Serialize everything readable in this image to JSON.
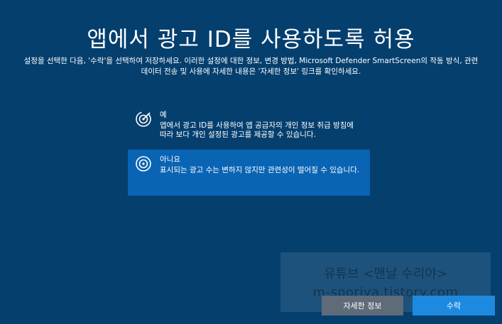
{
  "header": {
    "title": "앱에서 광고 ID를 사용하도록 허용",
    "description_line1": "설정을 선택한 다음, '수락'을 선택하여 저장하세요. 이러한 설정에 대한 정보, 변경 방법, Microsoft Defender SmartScreen의 작동 방식, 관련",
    "description_line2": "데이터 전송 및 사용에 자세한 내용은 '자세한 정보' 링크를 확인하세요."
  },
  "options": [
    {
      "title": "예",
      "body": "앱에서 광고 ID를 사용하여 앱 공급자의 개인 정보 취급 방침에 따라 보다 개인 설정된 광고를 제공할 수 있습니다.",
      "icon": "ad-id-on-icon",
      "selected": false
    },
    {
      "title": "아니요",
      "body": "표시되는 광고 수는 변하지 않지만 관련성이 떨어질 수 있습니다.",
      "icon": "ad-id-off-icon",
      "selected": true
    }
  ],
  "watermark": {
    "line1": "유튜브 <맨날 수리야>",
    "line2": "m-sooriya.tistory.com"
  },
  "buttons": {
    "learn_more": "자세한 정보",
    "accept": "수락"
  },
  "colors": {
    "background": "#043f6e",
    "selected_option": "#0a64b4",
    "accept_button": "#1d8ae0",
    "learn_more_button": "#5e6b78"
  }
}
